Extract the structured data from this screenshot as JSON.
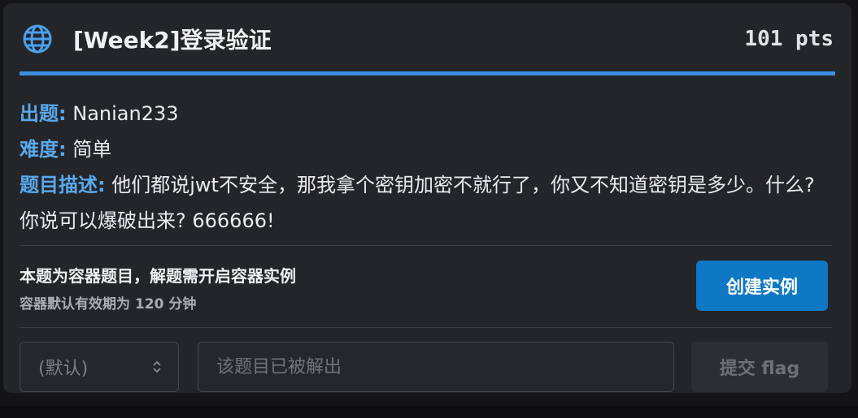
{
  "challenge": {
    "title": "[Week2]登录验证",
    "points": "101 pts",
    "icon": "globe-icon"
  },
  "info": {
    "author_label": "出题:",
    "author": "Nanian233",
    "difficulty_label": "难度:",
    "difficulty": "简单",
    "description_label": "题目描述:",
    "description": "他们都说jwt不安全，那我拿个密钥加密不就行了，你又不知道密钥是多少。什么? 你说可以爆破出来? 666666!"
  },
  "container": {
    "title": "本题为容器题目，解题需开启容器实例",
    "subtitle": "容器默认有效期为 120 分钟",
    "create_button": "创建实例"
  },
  "submit": {
    "select_value": "(默认)",
    "input_placeholder": "该题目已被解出",
    "submit_button": "提交 flag"
  },
  "colors": {
    "accent": "#3f8fe0",
    "label": "#58a9ee",
    "primary_button": "#0f78c4",
    "card_bg": "#242528"
  }
}
